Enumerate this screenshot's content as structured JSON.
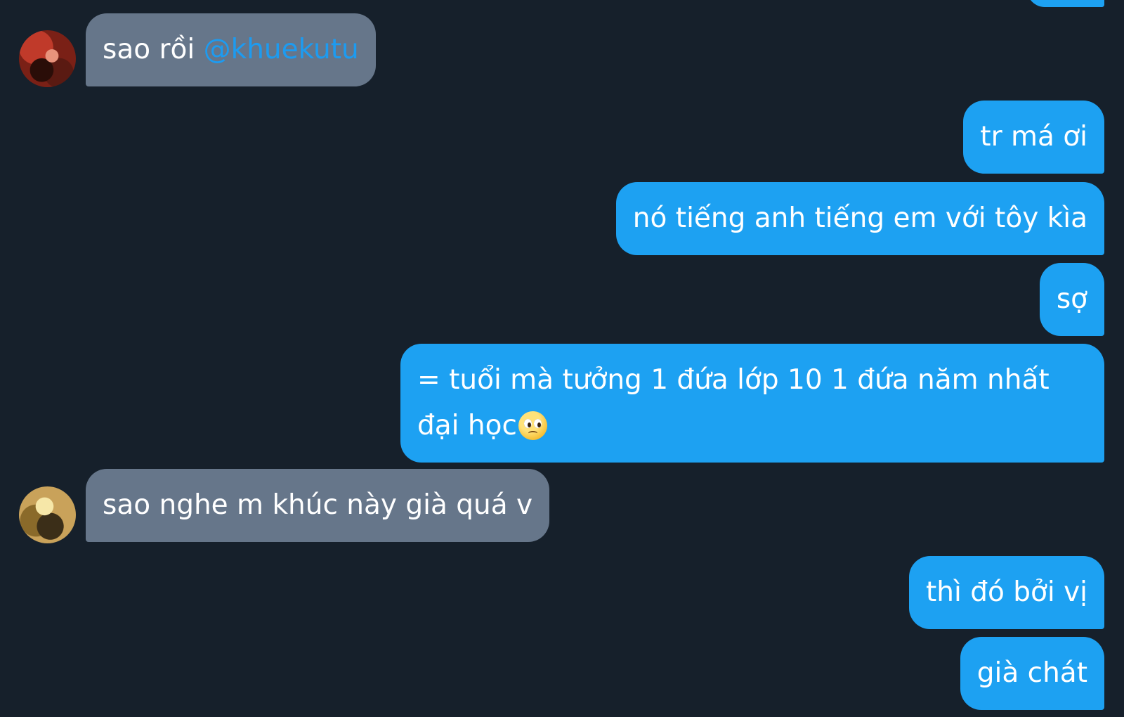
{
  "colors": {
    "background": "#16202b",
    "incoming_bubble": "#66768a",
    "outgoing_bubble": "#1da1f2",
    "mention": "#1d9bf0"
  },
  "messages": [
    {
      "direction": "in",
      "text": "sao rồi ",
      "mention": "@khuekutu",
      "avatar": "avatar-red-photo"
    },
    {
      "direction": "out",
      "text": "tr má ơi"
    },
    {
      "direction": "out",
      "text": "nó tiếng anh tiếng em với tôy kìa"
    },
    {
      "direction": "out",
      "text": "sợ"
    },
    {
      "direction": "out",
      "text": "= tuổi mà tưởng 1 đứa lớp 10 1 đứa năm nhất đại học",
      "emoji": "pleading-face-icon"
    },
    {
      "direction": "in",
      "text": "sao nghe m khúc này già quá v",
      "avatar": "avatar-blonde-photo"
    },
    {
      "direction": "out",
      "text": "thì đó bởi vị"
    },
    {
      "direction": "out",
      "text": "già chát"
    }
  ]
}
